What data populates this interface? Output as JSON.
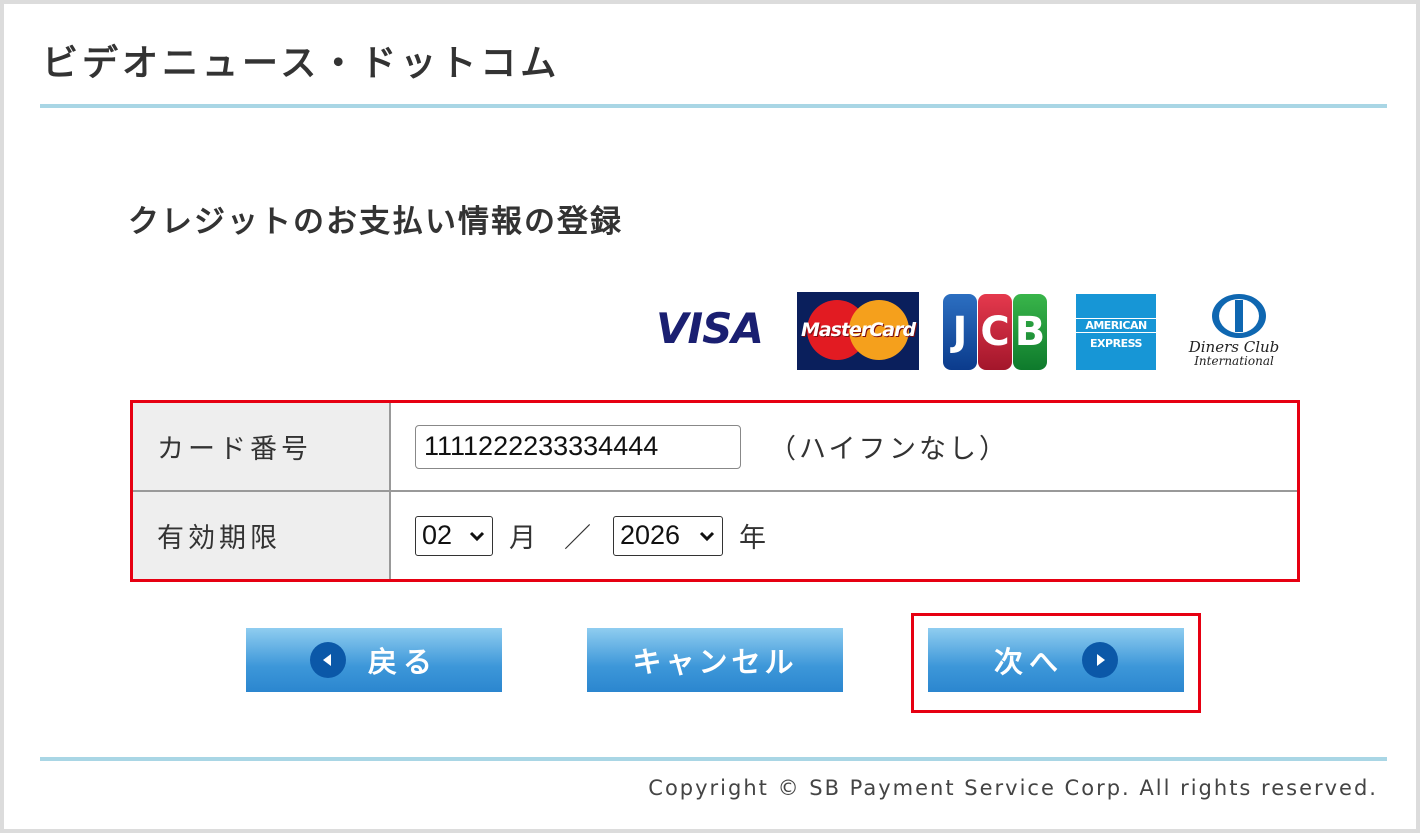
{
  "header": {
    "site_title": "ビデオニュース・ドットコム"
  },
  "page": {
    "title": "クレジットのお支払い情報の登録"
  },
  "cards": {
    "visa": "VISA",
    "mastercard": "MasterCard",
    "jcb": [
      "J",
      "C",
      "B"
    ],
    "amex": [
      "AMERICAN",
      "EXPRESS"
    ],
    "diners": [
      "Diners Club",
      "International"
    ]
  },
  "form": {
    "card_number_label": "カード番号",
    "card_number_value": "1111222233334444",
    "card_number_hint": "（ハイフンなし）",
    "expiry_label": "有効期限",
    "month_value": "02",
    "month_unit": "月",
    "separator": "／",
    "year_value": "2026",
    "year_unit": "年"
  },
  "buttons": {
    "back": "戻る",
    "cancel": "キャンセル",
    "next": "次へ"
  },
  "footer": {
    "copyright": "Copyright © SB Payment Service Corp. All rights reserved."
  },
  "colors": {
    "accent_rule": "#a9d6e5",
    "highlight": "#e60012",
    "button": "#3d97d9"
  }
}
